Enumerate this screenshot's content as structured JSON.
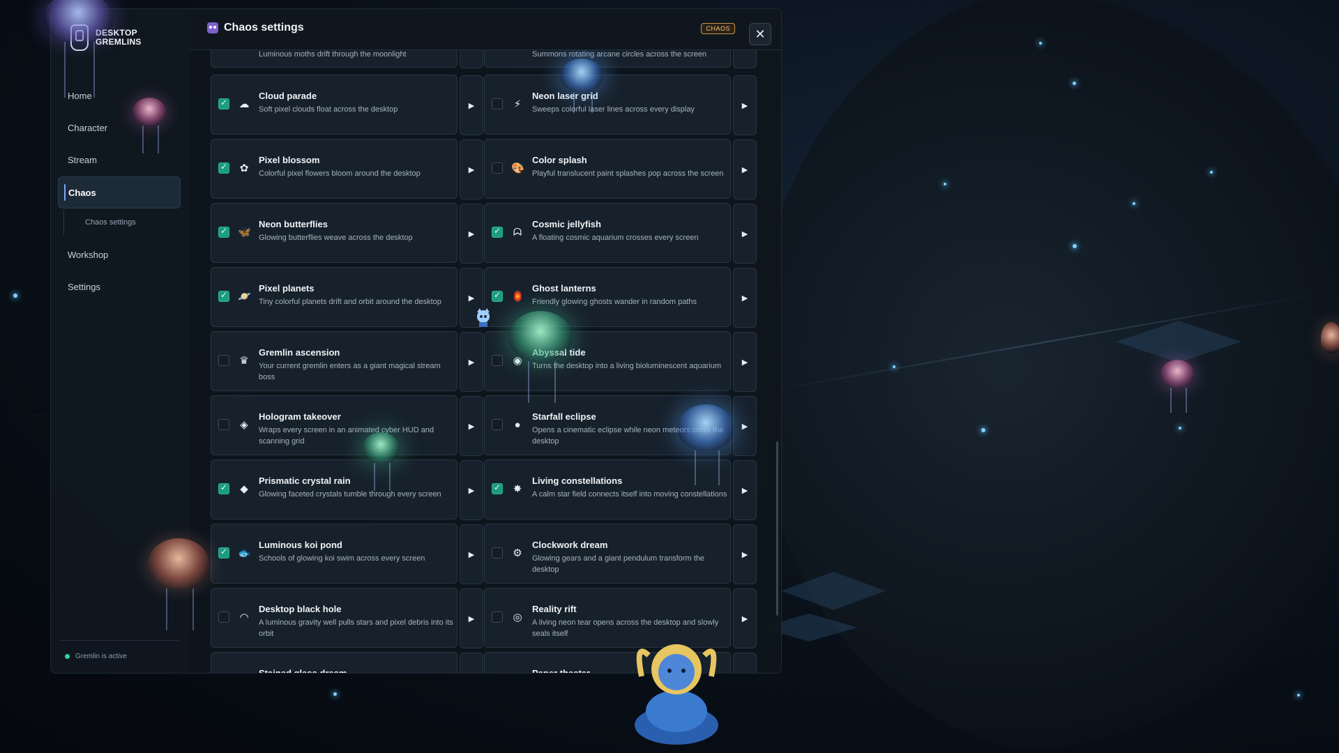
{
  "app": {
    "brand_line1": "DESKTOP",
    "brand_line2": "GREMLINS"
  },
  "sidebar": {
    "items": [
      {
        "label": "Home"
      },
      {
        "label": "Character"
      },
      {
        "label": "Stream"
      },
      {
        "label": "Chaos"
      },
      {
        "label": "Workshop"
      },
      {
        "label": "Settings"
      }
    ],
    "sub_item": "Chaos settings",
    "status": "Gremlin is active"
  },
  "panel": {
    "title": "Chaos settings",
    "badge": "CHAOS",
    "close": "✕"
  },
  "top_partial": {
    "left_desc": "Luminous moths drift through the moonlight",
    "right_desc": "Summons rotating arcane circles across the screen"
  },
  "effects": [
    {
      "name": "Cloud parade",
      "desc": "Soft pixel clouds float across the desktop",
      "enabled": true,
      "icon": "☁"
    },
    {
      "name": "Neon laser grid",
      "desc": "Sweeps colorful laser lines across every display",
      "enabled": false,
      "icon": "⚡"
    },
    {
      "name": "Pixel blossom",
      "desc": "Colorful pixel flowers bloom around the desktop",
      "enabled": true,
      "icon": "✿"
    },
    {
      "name": "Color splash",
      "desc": "Playful translucent paint splashes pop across the screen",
      "enabled": false,
      "icon": "🎨"
    },
    {
      "name": "Neon butterflies",
      "desc": "Glowing butterflies weave across the desktop",
      "enabled": true,
      "icon": "🦋"
    },
    {
      "name": "Cosmic jellyfish",
      "desc": "A floating cosmic aquarium crosses every screen",
      "enabled": true,
      "icon": "ᗣ"
    },
    {
      "name": "Pixel planets",
      "desc": "Tiny colorful planets drift and orbit around the desktop",
      "enabled": true,
      "icon": "🪐"
    },
    {
      "name": "Ghost lanterns",
      "desc": "Friendly glowing ghosts wander in random paths",
      "enabled": true,
      "icon": "🏮"
    },
    {
      "name": "Gremlin ascension",
      "desc": "Your current gremlin enters as a giant magical stream boss",
      "enabled": false,
      "icon": "♛"
    },
    {
      "name": "Abyssal tide",
      "desc": "Turns the desktop into a living bioluminescent aquarium",
      "enabled": false,
      "icon": "◉"
    },
    {
      "name": "Hologram takeover",
      "desc": "Wraps every screen in an animated cyber HUD and scanning grid",
      "enabled": false,
      "icon": "◈"
    },
    {
      "name": "Starfall eclipse",
      "desc": "Opens a cinematic eclipse while neon meteors cross the desktop",
      "enabled": false,
      "icon": "●"
    },
    {
      "name": "Prismatic crystal rain",
      "desc": "Glowing faceted crystals tumble through every screen",
      "enabled": true,
      "icon": "◆"
    },
    {
      "name": "Living constellations",
      "desc": "A calm star field connects itself into moving constellations",
      "enabled": true,
      "icon": "✸"
    },
    {
      "name": "Luminous koi pond",
      "desc": "Schools of glowing koi swim across every screen",
      "enabled": true,
      "icon": "🐟"
    },
    {
      "name": "Clockwork dream",
      "desc": "Glowing gears and a giant pendulum transform the desktop",
      "enabled": false,
      "icon": "⚙"
    },
    {
      "name": "Desktop black hole",
      "desc": "A luminous gravity well pulls stars and pixel debris into its orbit",
      "enabled": false,
      "icon": "◠"
    },
    {
      "name": "Reality rift",
      "desc": "A living neon tear opens across the desktop and slowly seals itself",
      "enabled": false,
      "icon": "◎"
    },
    {
      "name": "Stained glass dream",
      "desc": "",
      "enabled": false,
      "icon": ""
    },
    {
      "name": "Paper theater",
      "desc": "",
      "enabled": false,
      "icon": ""
    }
  ],
  "play_symbol": "▶",
  "colors": {
    "accent": "#1f9b82",
    "badge": "#f1c27a",
    "panel_bg": "#0e151d"
  }
}
